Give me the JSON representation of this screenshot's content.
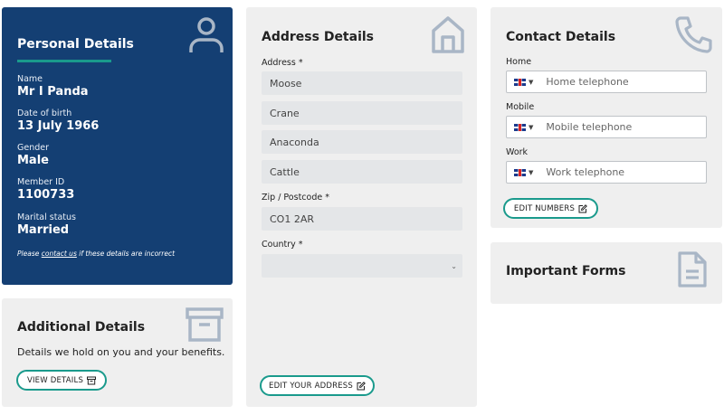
{
  "personal": {
    "title": "Personal Details",
    "fields": [
      {
        "label": "Name",
        "value": "Mr I Panda"
      },
      {
        "label": "Date of birth",
        "value": "13 July 1966"
      },
      {
        "label": "Gender",
        "value": "Male"
      },
      {
        "label": "Member ID",
        "value": "1100733"
      },
      {
        "label": "Marital status",
        "value": "Married"
      }
    ],
    "note_prefix": "Please ",
    "note_link": "contact us",
    "note_suffix": " if these details are incorrect",
    "icon": "user-icon"
  },
  "additional": {
    "title": "Additional Details",
    "description": "Details we hold on you and your benefits.",
    "button_label": "VIEW DETAILS",
    "icon": "archive-box-icon"
  },
  "address": {
    "title": "Address Details",
    "address_label": "Address *",
    "lines": [
      "Moose",
      "Crane",
      "Anaconda",
      "Cattle"
    ],
    "zip_label": "Zip / Postcode *",
    "zip_value": "CO1 2AR",
    "country_label": "Country *",
    "country_value": "",
    "button_label": "EDIT YOUR ADDRESS",
    "icon": "home-icon"
  },
  "contact": {
    "title": "Contact Details",
    "phones": [
      {
        "label": "Home",
        "placeholder": "Home telephone"
      },
      {
        "label": "Mobile",
        "placeholder": "Mobile telephone"
      },
      {
        "label": "Work",
        "placeholder": "Work telephone"
      }
    ],
    "button_label": "EDIT NUMBERS",
    "icon": "phone-icon"
  },
  "forms": {
    "title": "Important Forms",
    "icon": "document-icon"
  },
  "colors": {
    "navy": "#143f73",
    "teal": "#1a9a8c",
    "card_bg": "#efefef",
    "icon_grey": "#a9b6c6"
  }
}
